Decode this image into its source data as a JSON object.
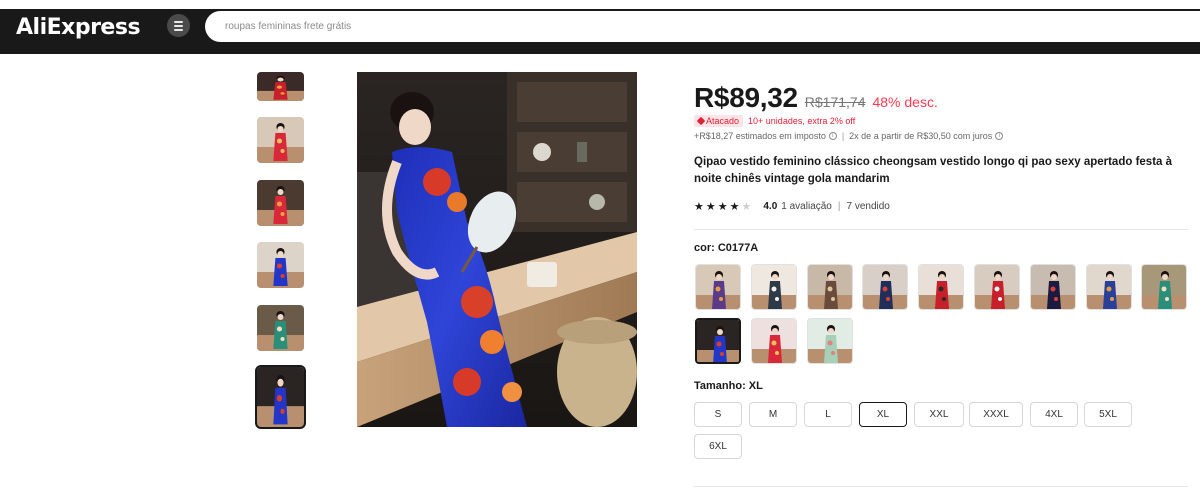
{
  "header": {
    "logo_text": "AliExpress",
    "menu_icon": "hamburger-icon",
    "search_placeholder": "roupas femininas frete grátis"
  },
  "product": {
    "price": "R$89,32",
    "original_price": "R$171,74",
    "discount": "48% desc.",
    "wholesale_badge": "Atacado",
    "wholesale_text": "10+ unidades, extra 2% off",
    "tax_text": "+R$18,27 estimados em imposto",
    "installments_text": "2x de a partir de R$30,50 com juros",
    "title": "Qipao vestido feminino clássico cheongsam vestido longo qi pao sexy apertado festa à noite chinês vintage gola mandarim",
    "rating": 4.0,
    "rating_text": "4.0",
    "reviews_text": "1 avaliação",
    "separator": "|",
    "sold_text": "7 vendido",
    "color_label": "cor: C0177A",
    "size_label": "Tamanho: XL",
    "sizes": [
      "S",
      "M",
      "L",
      "XL",
      "XXL",
      "XXXL",
      "4XL",
      "5XL",
      "6XL"
    ],
    "selected_size": "XL",
    "selected_color_index": 9
  },
  "colors": {
    "accent_red": "#fd384f",
    "header_bg": "#191919",
    "swatch_dresses": [
      "#5b3a8a",
      "#2f3a48",
      "#6a4a3a",
      "#1f2f5a",
      "#c8202a",
      "#c8202a",
      "#1d1a40",
      "#2a3f9a",
      "#2a8f7a",
      "#2436c8",
      "#d8283a",
      "#a8d0b8"
    ]
  }
}
